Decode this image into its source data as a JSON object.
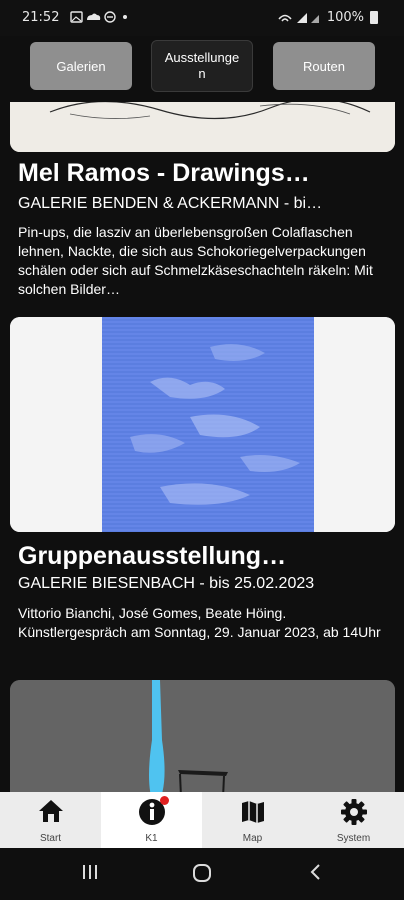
{
  "status_bar": {
    "time": "21:52",
    "battery": "100%"
  },
  "top_tabs": [
    {
      "label": "Galerien"
    },
    {
      "label": "Ausstellunge n"
    },
    {
      "label": "Routen"
    }
  ],
  "cards": [
    {
      "title": "Mel Ramos - Drawings…",
      "subtitle": "GALERIE BENDEN & ACKERMANN - bi…",
      "description": "Pin-ups, die lasziv an überlebensgroßen Colaflaschen lehnen, Nackte, die sich aus Schokoriegelverpackungen schälen oder sich auf Schmelzkäseschachteln räkeln: Mit solchen Bilder…"
    },
    {
      "title": "Gruppenausstellung…",
      "subtitle": "GALERIE BIESENBACH - bis 25.02.2023",
      "description": "Vittorio Bianchi, José Gomes, Beate Höing. Künstlergespräch am Sonntag, 29. Januar 2023, ab 14Uhr"
    }
  ],
  "bottom_nav": [
    {
      "label": "Start",
      "icon": "home-icon"
    },
    {
      "label": "K1",
      "icon": "info-icon"
    },
    {
      "label": "Map",
      "icon": "map-icon"
    },
    {
      "label": "System",
      "icon": "gear-icon"
    }
  ],
  "colors": {
    "background": "#0f0f0f",
    "tab": "#8f8f8f",
    "badge": "#e02020",
    "nav": "#ececec"
  }
}
